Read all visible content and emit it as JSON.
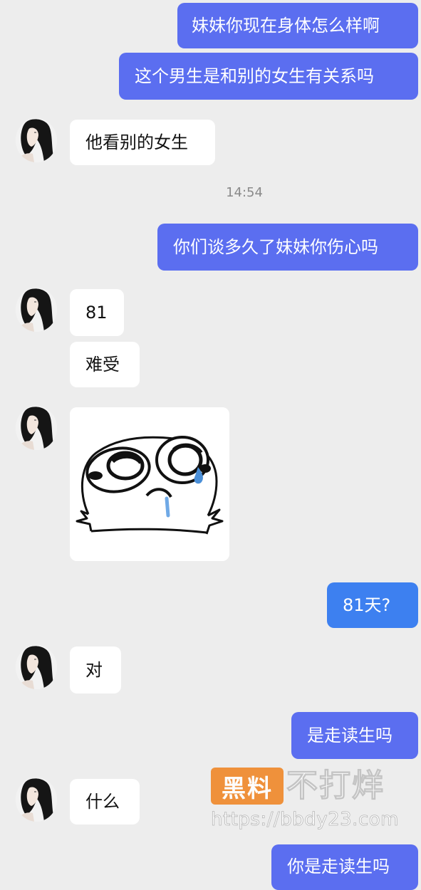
{
  "messages": {
    "m1": "妹妹你现在身体怎么样啊",
    "m2": "这个男生是和别的女生有关系吗",
    "m3": "他看别的女生",
    "m4": "你们谈多久了妹妹你伤心吗",
    "m5": "81",
    "m6": "难受",
    "m7": "81天?",
    "m8": "对",
    "m9": "是走读生吗",
    "m10": "什么",
    "m11": "你是走读生吗"
  },
  "timestamp": "14:54",
  "sticker": {
    "icon": "crying-face-sticker"
  },
  "watermark": {
    "badge": "黑料",
    "text": "不打烊",
    "url": "https://bbdy23.com"
  },
  "colors": {
    "outgoing_bubble": "#5b6ef0",
    "outgoing_bubble_alt": "#3d80f0",
    "incoming_bubble": "#ffffff",
    "background": "#ededed",
    "watermark_badge": "#f08a2c"
  }
}
